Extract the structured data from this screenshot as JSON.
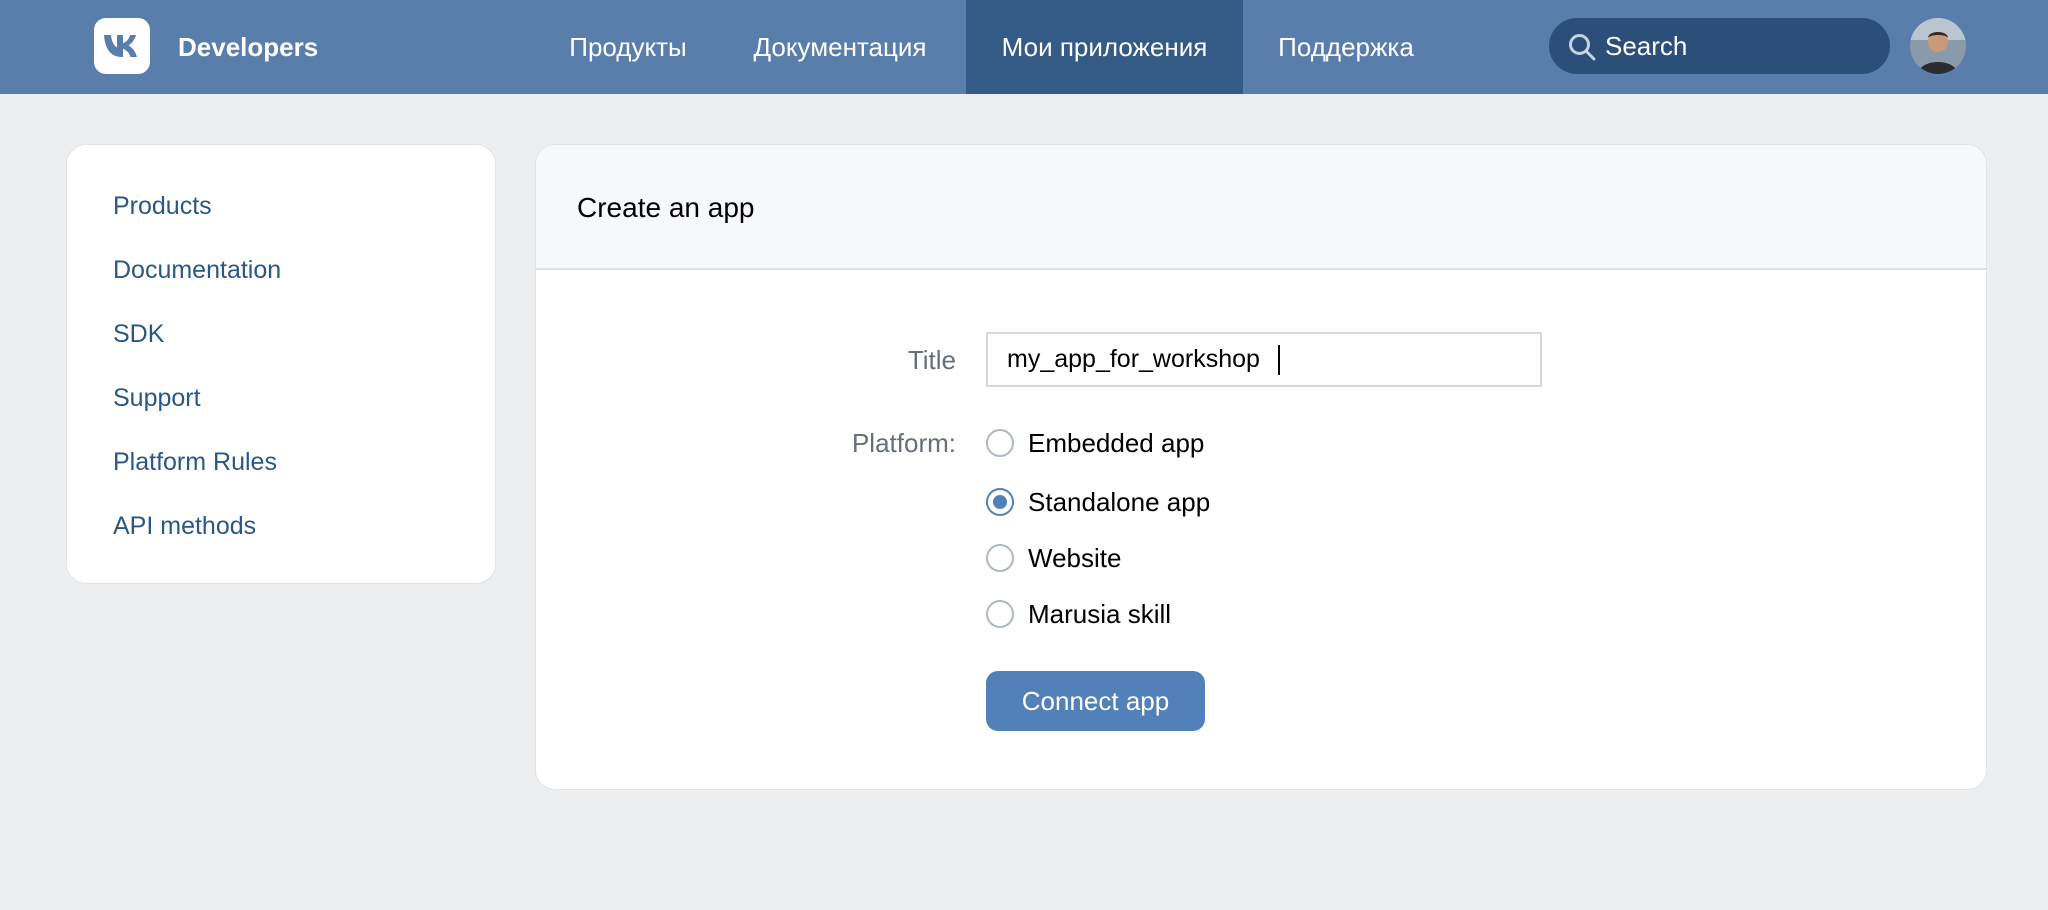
{
  "header": {
    "brand": "Developers",
    "logo_icon": "vk-logo-icon",
    "nav": [
      {
        "label": "Продукты",
        "active": false
      },
      {
        "label": "Документация",
        "active": false
      },
      {
        "label": "Мои приложения",
        "active": true
      },
      {
        "label": "Поддержка",
        "active": false
      }
    ],
    "search": {
      "placeholder": "Search",
      "icon": "search-icon"
    },
    "avatar_icon": "user-avatar"
  },
  "sidebar": {
    "items": [
      {
        "label": "Products"
      },
      {
        "label": "Documentation"
      },
      {
        "label": "SDK"
      },
      {
        "label": "Support"
      },
      {
        "label": "Platform Rules"
      },
      {
        "label": "API methods"
      }
    ]
  },
  "main": {
    "title": "Create an app",
    "form": {
      "title_label": "Title",
      "title_value": "my_app_for_workshop",
      "platform_label": "Platform:",
      "platforms": [
        {
          "label": "Embedded app",
          "checked": false
        },
        {
          "label": "Standalone app",
          "checked": true
        },
        {
          "label": "Website",
          "checked": false
        },
        {
          "label": "Marusia skill",
          "checked": false
        }
      ],
      "submit_label": "Connect app"
    }
  },
  "colors": {
    "header_bg": "#5a7eab",
    "active_nav_bg": "#345a86",
    "link": "#2a5885",
    "accent": "#5181b8",
    "page_bg": "#edeef0"
  }
}
